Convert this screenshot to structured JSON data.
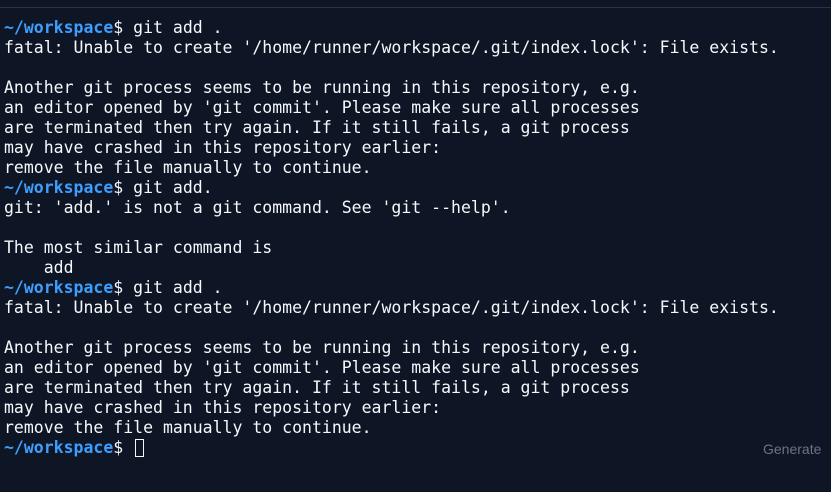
{
  "terminal": {
    "lines": [
      {
        "type": "prompt",
        "path": "~/workspace",
        "symbol": "$",
        "command": " git add ."
      },
      {
        "type": "output",
        "text": "fatal: Unable to create '/home/runner/workspace/.git/index.lock': File exists."
      },
      {
        "type": "output",
        "text": ""
      },
      {
        "type": "output",
        "text": "Another git process seems to be running in this repository, e.g."
      },
      {
        "type": "output",
        "text": "an editor opened by 'git commit'. Please make sure all processes"
      },
      {
        "type": "output",
        "text": "are terminated then try again. If it still fails, a git process"
      },
      {
        "type": "output",
        "text": "may have crashed in this repository earlier:"
      },
      {
        "type": "output",
        "text": "remove the file manually to continue."
      },
      {
        "type": "prompt",
        "path": "~/workspace",
        "symbol": "$",
        "command": " git add."
      },
      {
        "type": "output",
        "text": "git: 'add.' is not a git command. See 'git --help'."
      },
      {
        "type": "output",
        "text": ""
      },
      {
        "type": "output",
        "text": "The most similar command is"
      },
      {
        "type": "output",
        "text": "    add"
      },
      {
        "type": "prompt",
        "path": "~/workspace",
        "symbol": "$",
        "command": " git add ."
      },
      {
        "type": "output",
        "text": "fatal: Unable to create '/home/runner/workspace/.git/index.lock': File exists."
      },
      {
        "type": "output",
        "text": ""
      },
      {
        "type": "output",
        "text": "Another git process seems to be running in this repository, e.g."
      },
      {
        "type": "output",
        "text": "an editor opened by 'git commit'. Please make sure all processes"
      },
      {
        "type": "output",
        "text": "are terminated then try again. If it still fails, a git process"
      },
      {
        "type": "output",
        "text": "may have crashed in this repository earlier:"
      },
      {
        "type": "output",
        "text": "remove the file manually to continue."
      },
      {
        "type": "prompt",
        "path": "~/workspace",
        "symbol": "$",
        "command": " ",
        "cursor": true
      }
    ]
  },
  "hint": {
    "label": "Generate"
  },
  "colors": {
    "background": "#0e1525",
    "text": "#f5f9fc",
    "prompt_path": "#3c9fff",
    "hint": "#6b7385"
  }
}
